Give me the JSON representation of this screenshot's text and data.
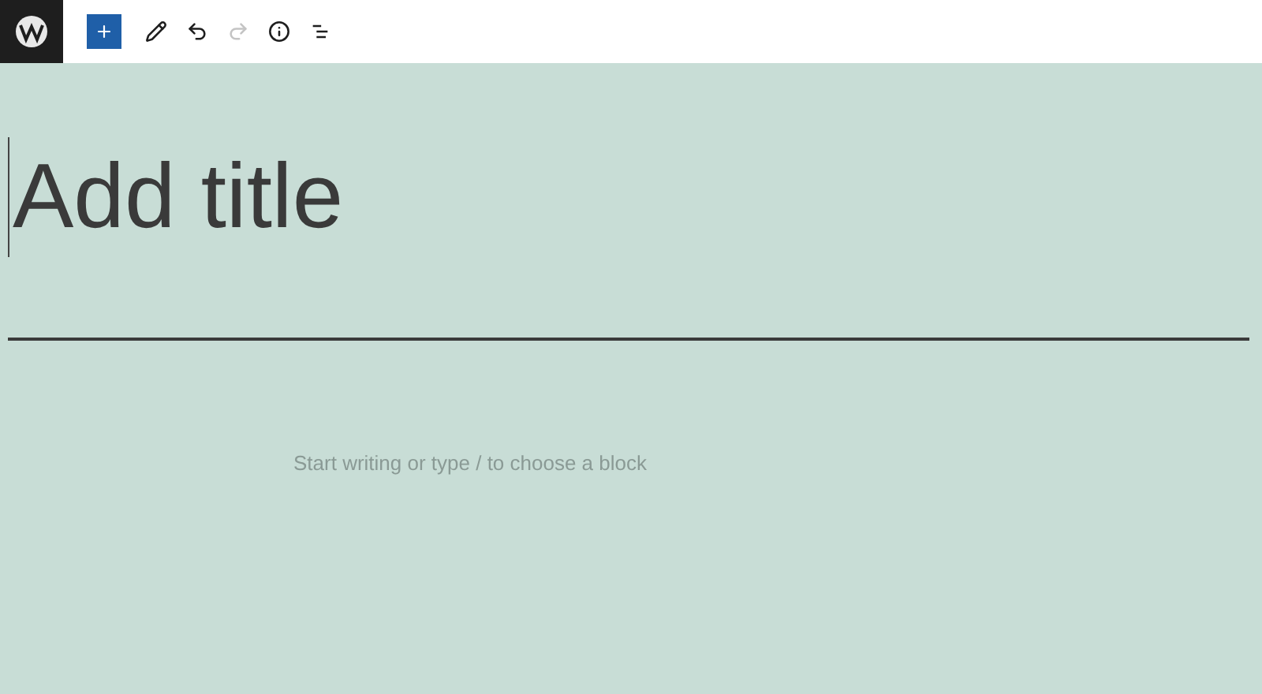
{
  "toolbar": {
    "tools": [
      {
        "kind": "add",
        "disabled": false
      },
      {
        "kind": "edit",
        "disabled": false
      },
      {
        "kind": "undo",
        "disabled": false
      },
      {
        "kind": "redo",
        "disabled": true
      },
      {
        "kind": "info",
        "disabled": false
      },
      {
        "kind": "outline",
        "disabled": false
      }
    ]
  },
  "editor": {
    "title": {
      "placeholder": "Add title"
    },
    "body": {
      "placeholder": "Start writing or type / to choose a block"
    }
  }
}
